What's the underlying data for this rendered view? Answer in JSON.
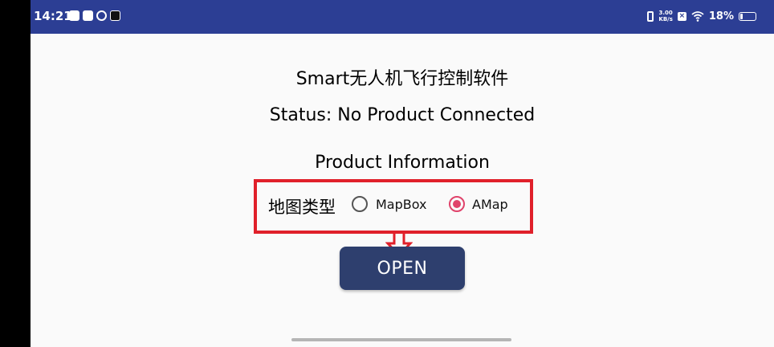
{
  "status_bar": {
    "time": "14:21",
    "net_speed_value": "3.00",
    "net_speed_unit": "KB/s",
    "battery_percent": "18%",
    "battery_level": 0.18,
    "background": "#2c3e94"
  },
  "app": {
    "title": "Smart无人机飞行控制软件",
    "status": "Status: No Product Connected",
    "product_info": "Product Information",
    "map_type_label": "地图类型",
    "map_options": [
      {
        "label": "MapBox",
        "checked": false
      },
      {
        "label": "AMap",
        "checked": true
      }
    ],
    "open_button": "OPEN"
  },
  "colors": {
    "highlight_border": "#e0202a",
    "radio_checked": "#e0436b",
    "button_bg": "#2e3f6e"
  }
}
